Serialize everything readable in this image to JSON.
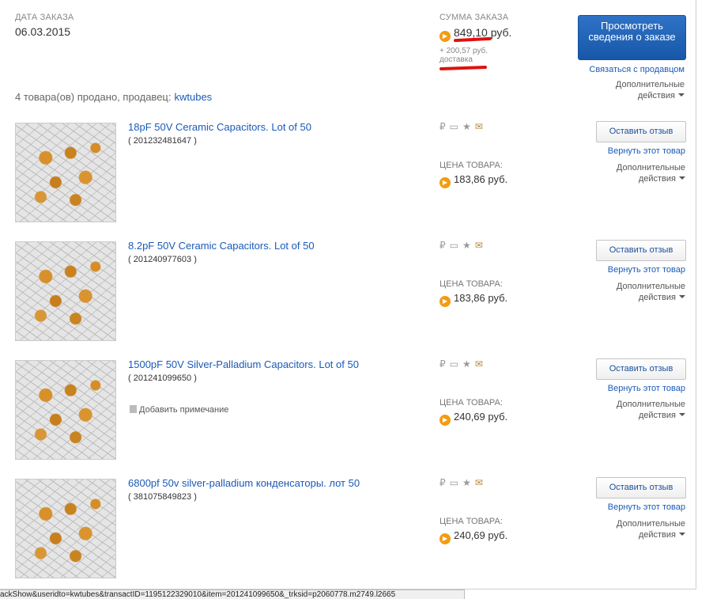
{
  "order": {
    "date_label": "ДАТА ЗАКАЗА",
    "date": "06.03.2015",
    "sum_label": "СУММА ЗАКАЗА",
    "sum": "849,10 руб.",
    "shipping_amount": "+ 200,57 руб.",
    "shipping_label": "доставка",
    "view_button": "Просмотреть сведения о заказе",
    "contact_seller": "Связаться с продавцом",
    "more_actions_1": "Дополнительные",
    "more_actions_2": "действия",
    "sold_text": "4 товара(ов) продано, продавец:",
    "seller": "kwtubes",
    "accent_color": "#f39c12",
    "highlight_color": "#e01010"
  },
  "items": [
    {
      "title": "18pF 50V Ceramic Capacitors. Lot of 50",
      "sku": "( 201232481647 )",
      "price_label": "ЦЕНА ТОВАРА:",
      "price": "183,86 руб.",
      "review": "Оставить отзыв",
      "return": "Вернуть этот товар",
      "more_1": "Дополнительные",
      "more_2": "действия"
    },
    {
      "title": "8.2pF 50V Ceramic Capacitors. Lot of 50",
      "sku": "( 201240977603 )",
      "price_label": "ЦЕНА ТОВАРА:",
      "price": "183,86 руб.",
      "review": "Оставить отзыв",
      "return": "Вернуть этот товар",
      "more_1": "Дополнительные",
      "more_2": "действия"
    },
    {
      "title": "1500pF 50V Silver-Palladium Capacitors. Lot of 50",
      "sku": "( 201241099650 )",
      "note": "Добавить примечание",
      "price_label": "ЦЕНА ТОВАРА:",
      "price": "240,69 руб.",
      "review": "Оставить отзыв",
      "return": "Вернуть этот товар",
      "more_1": "Дополнительные",
      "more_2": "действия"
    },
    {
      "title": "6800pf 50v silver-palladium конденсаторы. лот 50",
      "sku": "( 381075849823 )",
      "price_label": "ЦЕНА ТОВАРА:",
      "price": "240,69 руб.",
      "review": "Оставить отзыв",
      "return": "Вернуть этот товар",
      "more_1": "Дополнительные",
      "more_2": "действия"
    }
  ],
  "icons": {
    "ruble": "₽",
    "photo": "photo-icon",
    "star": "star-icon",
    "mail": "mail-icon"
  },
  "status_bar": "ackShow&useridto=kwtubes&transactID=1195122329010&item=201241099650&_trksid=p2060778.m2749.l2665"
}
